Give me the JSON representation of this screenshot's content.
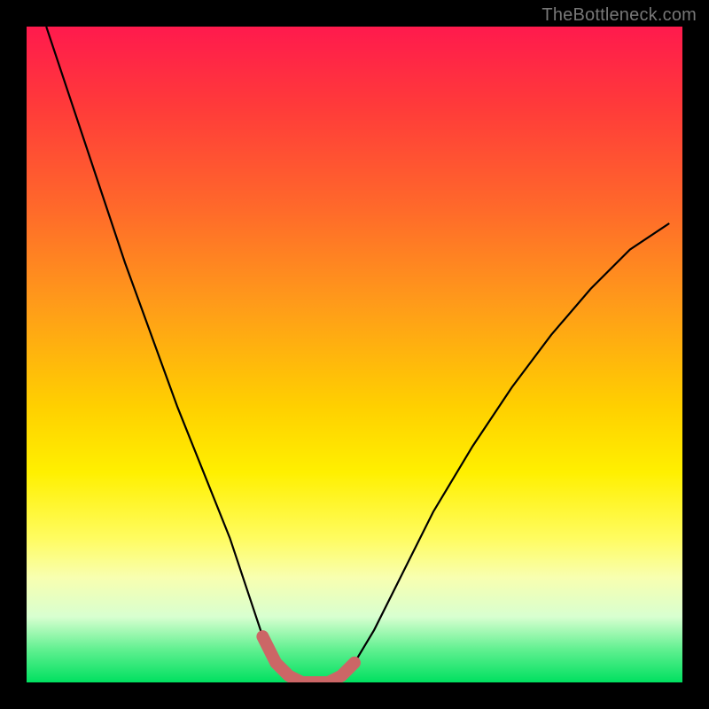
{
  "watermark": "TheBottleneck.com",
  "chart_data": {
    "type": "line",
    "title": "",
    "xlabel": "",
    "ylabel": "",
    "xlim": [
      0,
      100
    ],
    "ylim": [
      0,
      100
    ],
    "series": [
      {
        "name": "curve",
        "x": [
          3,
          7,
          11,
          15,
          19,
          23,
          27,
          31,
          34,
          36,
          38,
          40,
          42,
          44,
          46,
          48,
          50,
          53,
          57,
          62,
          68,
          74,
          80,
          86,
          92,
          98
        ],
        "y": [
          100,
          88,
          76,
          64,
          53,
          42,
          32,
          22,
          13,
          7,
          3,
          1,
          0,
          0,
          0,
          1,
          3,
          8,
          16,
          26,
          36,
          45,
          53,
          60,
          66,
          70
        ]
      },
      {
        "name": "highlight-band",
        "x": [
          36,
          38,
          40,
          42,
          44,
          46,
          48,
          50
        ],
        "y": [
          7,
          3,
          1,
          0,
          0,
          0,
          1,
          3
        ]
      }
    ],
    "background_gradient": {
      "top": "#ff1a4d",
      "mid": "#fff000",
      "bottom": "#00e060"
    }
  }
}
